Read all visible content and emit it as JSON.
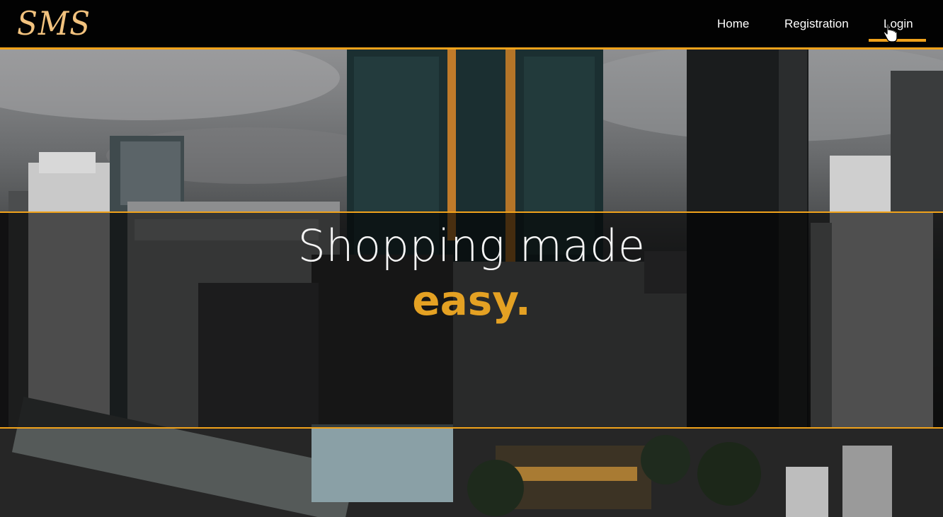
{
  "brand": {
    "logo_text": "SMS",
    "accent_color": "#f0a21b",
    "logo_color": "#f2c27e"
  },
  "nav": {
    "items": [
      {
        "label": "Home"
      },
      {
        "label": "Registration"
      },
      {
        "label": "Login",
        "active": true
      }
    ]
  },
  "hero": {
    "headline": "Shopping made",
    "headline_accent": "easy.",
    "background": "city skyline photo",
    "text_color": "#f5f5f5",
    "accent_text_color": "#e4a123"
  },
  "icons": {
    "cursor": "hand-pointer-cursor"
  }
}
